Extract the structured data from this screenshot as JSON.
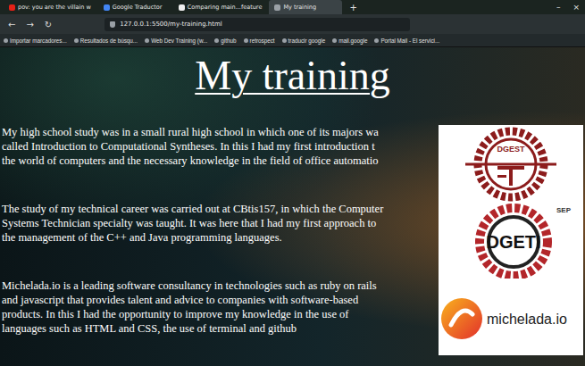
{
  "window": {
    "title": "My training"
  },
  "tabs": [
    {
      "label": "pov: you are the villain w",
      "selected": false,
      "color": "#e62117"
    },
    {
      "label": "Google Traductor",
      "selected": false,
      "color": "#4285f4"
    },
    {
      "label": "Comparing main...feature",
      "selected": false,
      "color": "#f0f0f0"
    },
    {
      "label": "My training",
      "selected": true,
      "color": "#9aa0a6"
    }
  ],
  "new_tab": "+",
  "window_controls": [
    "–",
    "×"
  ],
  "nav": [
    "←",
    "→",
    "↻"
  ],
  "address_bar": {
    "url": "127.0.0.1:5500/my-training.html"
  },
  "bookmarks": [
    "Importar marcadores...",
    "Resultados de búsqu...",
    "Web Dev Training (w...",
    "github",
    "retrospect",
    "traducir google",
    "mail.google",
    "Portal Mail - El servici..."
  ],
  "page": {
    "heading": "My training",
    "sections": [
      {
        "lines": [
          "My high school study was in a small rural high school in which one of its majors wa",
          "called Introduction to Computational Syntheses. In this I had my first introduction t",
          "the world of computers and the necessary knowledge in the field of office automatio"
        ],
        "logo": {
          "kind": "dgest",
          "text": "DGEST",
          "badge": ""
        }
      },
      {
        "lines": [
          "The study of my technical career was carried out at CBtis157, in which the Computer",
          "Systems Technician specialty was taught. It was here that I had my first approach to",
          "the management of the C++ and Java programming languages."
        ],
        "logo": {
          "kind": "dgeti",
          "text": "DGETI",
          "badge": "SEP"
        }
      },
      {
        "lines": [
          "Michelada.io is a leading software consultancy in technologies such as ruby on rails",
          "and javascript that provides talent and advice to companies with software-based",
          "products. In this I had the opportunity to improve my knowledge in the use of",
          "languages such as HTML and CSS, the use of terminal and github"
        ],
        "logo": {
          "kind": "michelada",
          "text": "michelada.io",
          "badge": ""
        }
      }
    ]
  }
}
